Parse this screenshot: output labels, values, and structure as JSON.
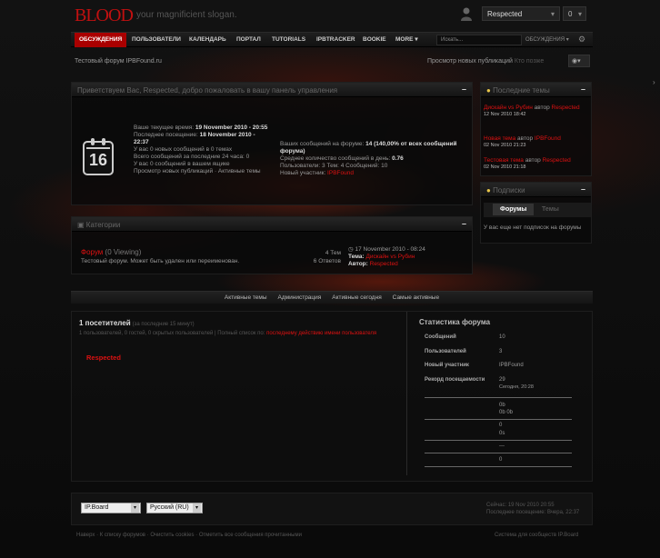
{
  "header": {
    "logo": "BLOOD",
    "slogan": "your magnificient slogan.",
    "user_menu": "Respected",
    "notif_count": "0"
  },
  "nav": {
    "items": [
      "ОБСУЖДЕНИЯ",
      "ПОЛЬЗОВАТЕЛИ",
      "КАЛЕНДАРЬ",
      "ПОРТАЛ",
      "TUTORIALS",
      "IPBTRACKER",
      "BOOKIE",
      "MORE"
    ],
    "search_placeholder": "Искать...",
    "search_scope": "ОБСУЖДЕНИЯ"
  },
  "breadcrumb": "Тестовый форум IPBFound.ru",
  "new_posts": "Просмотр новых публикаций",
  "login_link": "Кто позже",
  "welcome": {
    "title": "Приветствуем Вас, Respected, добро пожаловать в вашу панель управления",
    "calendar_day": "16",
    "left_lines": [
      {
        "label": "Ваше текущее время:",
        "value": "19 November 2010 - 20:55"
      },
      {
        "label": "Последнее посещение:",
        "value": "18 November 2010 - 22:37"
      },
      {
        "text": "У вас 0 новых сообщений в 0 темах"
      },
      {
        "text": "Всего сообщений за последние 24 часа: 0"
      },
      {
        "text": "У вас 0 сообщений в вашем ящике"
      }
    ],
    "active_link": "Просмотр новых публикаций · Активные темы",
    "right_lines": [
      {
        "label": "Ваших сообщений на форуме:",
        "value": "14 (140,00% от всех сообщений форума)"
      },
      {
        "label": "Среднее количество сообщений в день:",
        "value": "0.76"
      },
      {
        "text": "Пользователи: 3   Тем: 4   Сообщений: 10"
      },
      {
        "label": "Новый участник:",
        "value": "IPBFound"
      }
    ]
  },
  "categories": {
    "title": "Категории",
    "forum_name": "Форум",
    "viewing": "(0 Viewing)",
    "forum_desc": "Тестовый форум. Может быть удален или переименован.",
    "topics": "4 Тем",
    "replies": "6 Ответов",
    "last_date": "17 November 2010 - 08:24",
    "last_topic_label": "Тема:",
    "last_topic": "Дискайн vs Рубин",
    "last_author_label": "Автор:",
    "last_author": "Respected"
  },
  "latest_topics": {
    "title": "Последние темы",
    "items": [
      {
        "topic": "Дискайн vs Рубин",
        "by": "автор",
        "author": "Respected",
        "date": "12 Nov 2010 18:42"
      },
      {
        "topic": "Новая тема",
        "by": "автор",
        "author": "IPBFound",
        "date": "02 Nov 2010 21:23"
      },
      {
        "topic": "Тестовая тема",
        "by": "автор",
        "author": "Respected",
        "date": "02 Nov 2010 21:18"
      }
    ]
  },
  "subscriptions": {
    "title": "Подписки",
    "tabs": [
      "Форумы",
      "Темы"
    ],
    "empty": "У вас еще нет подписок на форумы"
  },
  "footer_links": [
    "Активные темы",
    "Администрация",
    "Активные сегодня",
    "Самые активные"
  ],
  "online": {
    "heading": "1 посетителей",
    "heading_note": "(за последние 15 минут)",
    "detail": "1 пользователей, 0 гостей, 0 скрытых пользователей | Полный список по:",
    "detail_link": "последнему действию имени пользователя",
    "user": "Respected"
  },
  "forum_stats": {
    "title": "Статистика форума",
    "rows": [
      {
        "label": "Сообщений",
        "value": "10"
      },
      {
        "label": "Пользователей",
        "value": "3"
      },
      {
        "label": "Новый участник",
        "value": "IPBFound"
      },
      {
        "label": "Рекорд посещаемости",
        "value": "29",
        "sub": "Сегодня, 20:28"
      }
    ],
    "extra": [
      "0b",
      "0b 0b",
      "0",
      "0s",
      "---",
      "0"
    ]
  },
  "bottom": {
    "skin": "IP.Board",
    "lang": "Русский (RU)",
    "time_line1": "Сейчас: 19 Nov 2010 20:55",
    "time_line2": "Последнее посещение: Вчера, 22:37",
    "links": [
      "Наверх",
      "К списку форумов",
      "Очистить cookies",
      "Отметить все сообщения прочитанными"
    ],
    "powered": "Система для сообществ IP.Board"
  }
}
